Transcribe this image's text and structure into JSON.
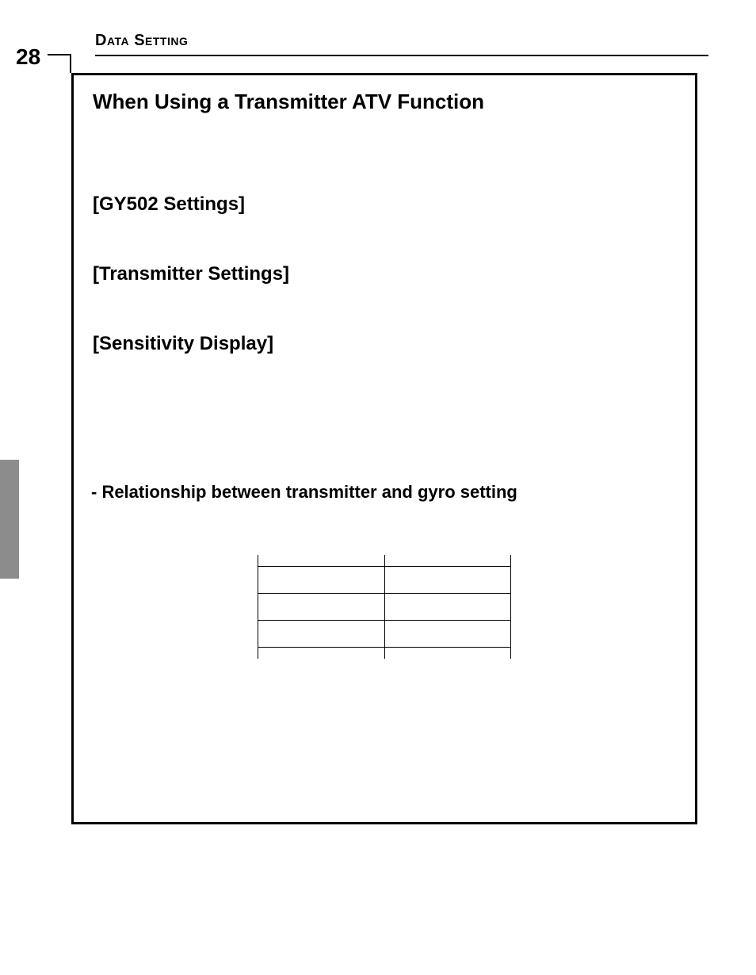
{
  "header": {
    "section": "Data Setting"
  },
  "page_number": "28",
  "box": {
    "title": "When Using a Transmitter ATV Function",
    "sub1": "[GY502 Settings]",
    "sub2": "[Transmitter Settings]",
    "sub3": "[Sensitivity Display]",
    "relation": "- Relationship between transmitter and gyro setting",
    "table": {
      "rows": [
        {
          "c1": "",
          "c2": ""
        },
        {
          "c1": "",
          "c2": ""
        },
        {
          "c1": "",
          "c2": ""
        }
      ]
    }
  }
}
